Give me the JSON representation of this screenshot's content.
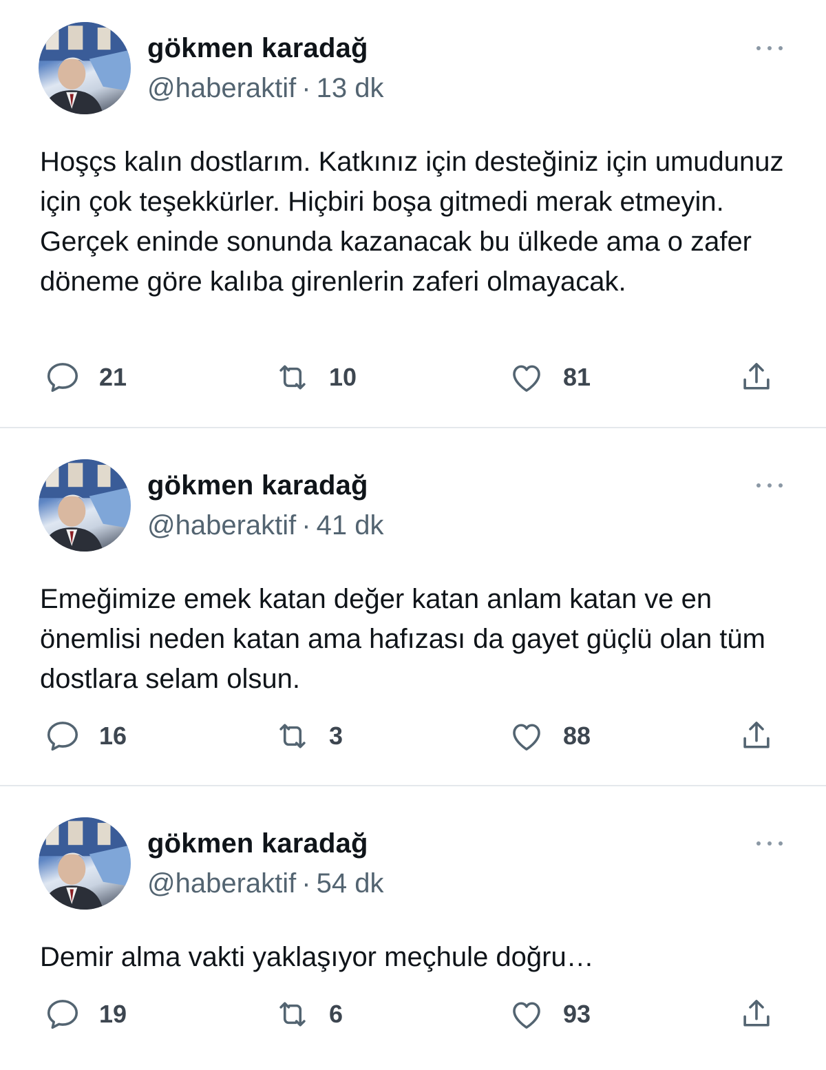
{
  "tweets": [
    {
      "author_name": "gökmen karadağ",
      "handle": "@haberaktif",
      "separator": "·",
      "time": "13 dk",
      "text": "Hoşçs kalın dostlarım. Katkınız için desteğiniz için umudunuz için çok teşekkürler. Hiçbiri boşa gitmedi merak etmeyin. Gerçek eninde sonunda kazanacak bu ülkede ama o zafer döneme göre kalıba girenlerin zaferi olmayacak.",
      "replies": "21",
      "retweets": "10",
      "likes": "81"
    },
    {
      "author_name": "gökmen karadağ",
      "handle": "@haberaktif",
      "separator": "·",
      "time": "41 dk",
      "text": "Emeğimize emek katan değer katan anlam katan ve en önemlisi neden katan ama hafızası da gayet güçlü olan tüm dostlara selam olsun.",
      "replies": "16",
      "retweets": "3",
      "likes": "88"
    },
    {
      "author_name": "gökmen karadağ",
      "handle": "@haberaktif",
      "separator": "·",
      "time": "54 dk",
      "text": "Demir alma vakti yaklaşıyor meçhule doğru…",
      "replies": "19",
      "retweets": "6",
      "likes": "93"
    }
  ],
  "icons": {
    "reply": "speech-bubble-icon",
    "retweet": "retweet-arrows-icon",
    "like": "heart-icon",
    "share": "share-upload-icon",
    "more": "more-dots-icon"
  },
  "colors": {
    "text_primary": "#0f1419",
    "text_secondary": "#536471",
    "icon": "#536471",
    "divider": "#e4e8ec"
  }
}
